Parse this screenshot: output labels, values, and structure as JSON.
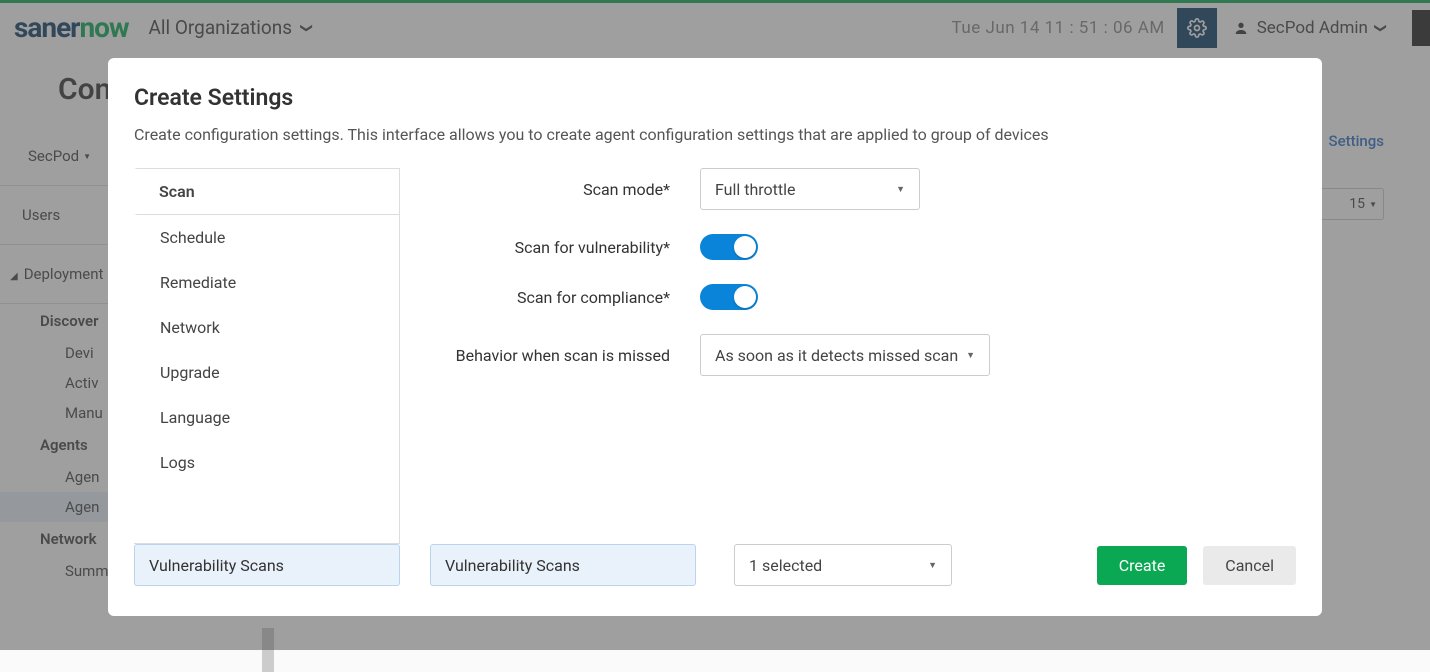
{
  "brand": {
    "left": "saner",
    "right": "now"
  },
  "org_picker": "All Organizations",
  "clock": "Tue Jun 14  11 : 51 : 06 AM",
  "user": "SecPod Admin",
  "bg": {
    "title_partial": "Cont",
    "secpod": "SecPod",
    "users": "Users",
    "deployment": "Deployment",
    "discovery": "Discover",
    "devi": "Devi",
    "activ": "Activ",
    "manu": "Manu",
    "agents": "Agents",
    "agen1": "Agen",
    "agen2": "Agen",
    "network": "Network",
    "summary": "Summary",
    "settings_link": "Settings",
    "count": "15"
  },
  "modal": {
    "title": "Create Settings",
    "description": "Create configuration settings. This interface allows you to create agent configuration settings that are applied to group of devices",
    "tabs": {
      "scan": "Scan",
      "schedule": "Schedule",
      "remediate": "Remediate",
      "network": "Network",
      "upgrade": "Upgrade",
      "language": "Language",
      "logs": "Logs"
    },
    "form": {
      "scan_mode_label": "Scan mode*",
      "scan_mode_value": "Full throttle",
      "scan_vuln_label": "Scan for vulnerability*",
      "scan_comp_label": "Scan for compliance*",
      "missed_label": "Behavior when scan is missed",
      "missed_value": "As soon as it detects missed scan"
    },
    "footer": {
      "input1": "Vulnerability Scans",
      "input2": "Vulnerability Scans",
      "group_select": "1 selected",
      "create": "Create",
      "cancel": "Cancel"
    }
  }
}
